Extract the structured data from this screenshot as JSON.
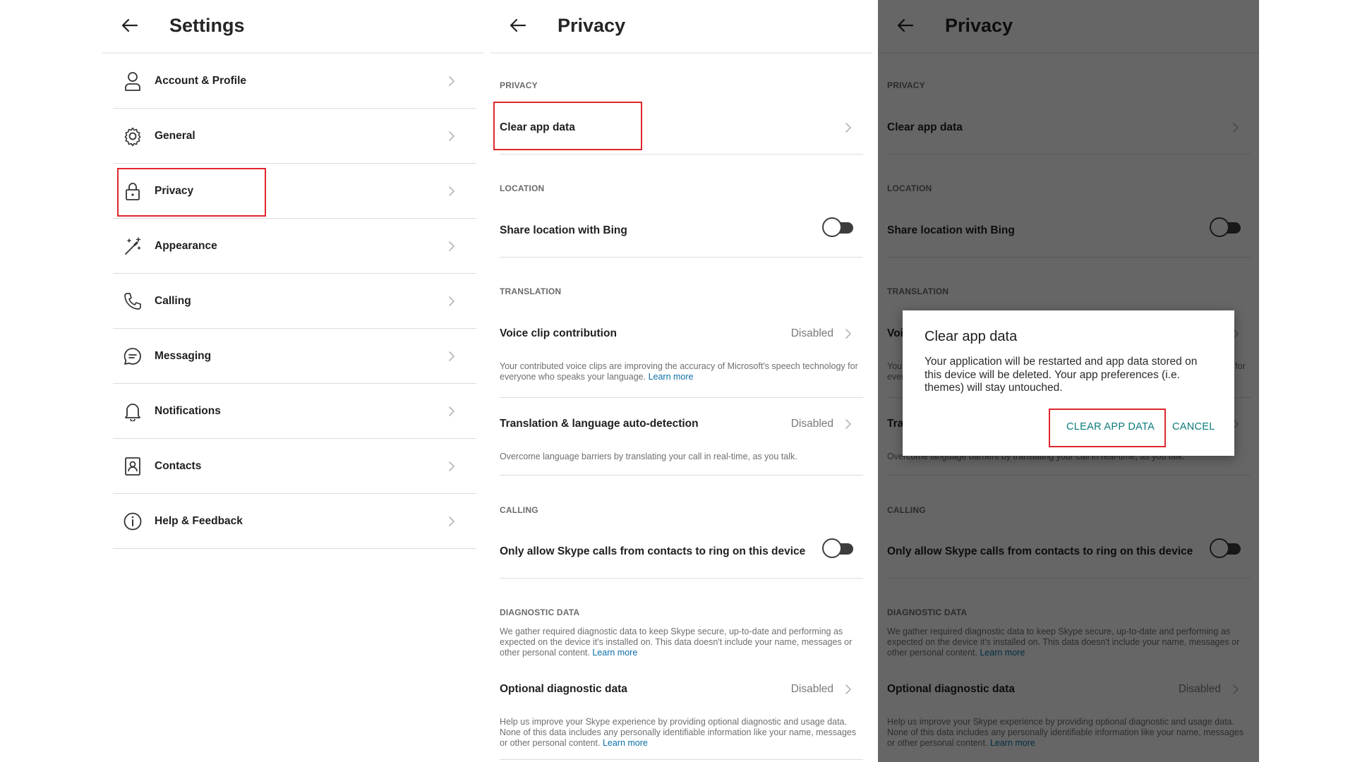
{
  "settings": {
    "title": "Settings",
    "items": [
      {
        "label": "Account & Profile"
      },
      {
        "label": "General"
      },
      {
        "label": "Privacy"
      },
      {
        "label": "Appearance"
      },
      {
        "label": "Calling"
      },
      {
        "label": "Messaging"
      },
      {
        "label": "Notifications"
      },
      {
        "label": "Contacts"
      },
      {
        "label": "Help & Feedback"
      }
    ]
  },
  "privacy": {
    "title": "Privacy",
    "sections": {
      "privacy": "PRIVACY",
      "location": "LOCATION",
      "translation": "TRANSLATION",
      "calling": "CALLING",
      "diagnostic": "DIAGNOSTIC DATA"
    },
    "clear_app_data": "Clear app data",
    "share_location": {
      "label": "Share location with Bing",
      "on": false
    },
    "voice_clip": {
      "label": "Voice clip contribution",
      "value": "Disabled",
      "desc": "Your contributed voice clips are improving the accuracy of Microsoft's speech technology for everyone who speaks your language.",
      "link": "Learn more"
    },
    "translation_auto": {
      "label": "Translation & language auto-detection",
      "value": "Disabled",
      "desc": "Overcome language barriers by translating your call in real-time, as you talk."
    },
    "skype_calls": {
      "label": "Only allow Skype calls from contacts to ring on this device",
      "on": false
    },
    "diagnostic_desc": "We gather required diagnostic data to keep Skype secure, up-to-date and performing as expected on the device it's installed on. This data doesn't include your name, messages or other personal content.",
    "diagnostic_link": "Learn more",
    "optional_diag": {
      "label": "Optional diagnostic data",
      "value": "Disabled",
      "desc": "Help us improve your Skype experience by providing optional diagnostic and usage data. None of this data includes any personally identifiable information like your name, messages or other personal content.",
      "link": "Learn more"
    }
  },
  "dialog": {
    "title": "Clear app data",
    "body": "Your application will be restarted and app data stored on this device will be deleted. Your app preferences (i.e. themes) will stay untouched.",
    "confirm": "CLEAR APP DATA",
    "cancel": "CANCEL"
  },
  "colors": {
    "highlight": "#e0262d",
    "link": "#0a6ea8",
    "dialog_button": "#0a7a7a"
  }
}
